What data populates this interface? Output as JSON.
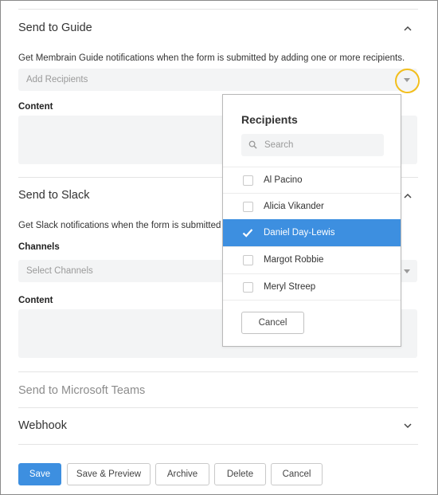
{
  "guide": {
    "title": "Send to Guide",
    "description": "Get Membrain Guide notifications when the form is submitted by adding one or more recipients.",
    "recipients_placeholder": "Add Recipients",
    "content_label": "Content"
  },
  "slack": {
    "title": "Send to Slack",
    "description": "Get Slack notifications when the form is submitted to",
    "channels_label": "Channels",
    "channels_placeholder": "Select Channels",
    "content_label": "Content"
  },
  "teams": {
    "title": "Send to Microsoft Teams"
  },
  "webhook": {
    "title": "Webhook"
  },
  "dropdown": {
    "title": "Recipients",
    "search_placeholder": "Search",
    "items": [
      {
        "name": "Al Pacino",
        "selected": false
      },
      {
        "name": "Alicia Vikander",
        "selected": false
      },
      {
        "name": "Daniel Day-Lewis",
        "selected": true
      },
      {
        "name": "Margot Robbie",
        "selected": false
      },
      {
        "name": "Meryl Streep",
        "selected": false
      }
    ],
    "cancel_label": "Cancel"
  },
  "footer": {
    "save": "Save",
    "save_preview": "Save & Preview",
    "archive": "Archive",
    "delete": "Delete",
    "cancel": "Cancel"
  },
  "colors": {
    "accent": "#3d8fe0",
    "highlight_ring": "#f2be1c",
    "field_bg": "#f3f4f5"
  },
  "icons": {
    "collapse": "chevron-up-icon",
    "expand": "chevron-down-icon",
    "dropdown_caret": "caret-down-icon",
    "search": "search-icon",
    "check": "check-icon"
  }
}
